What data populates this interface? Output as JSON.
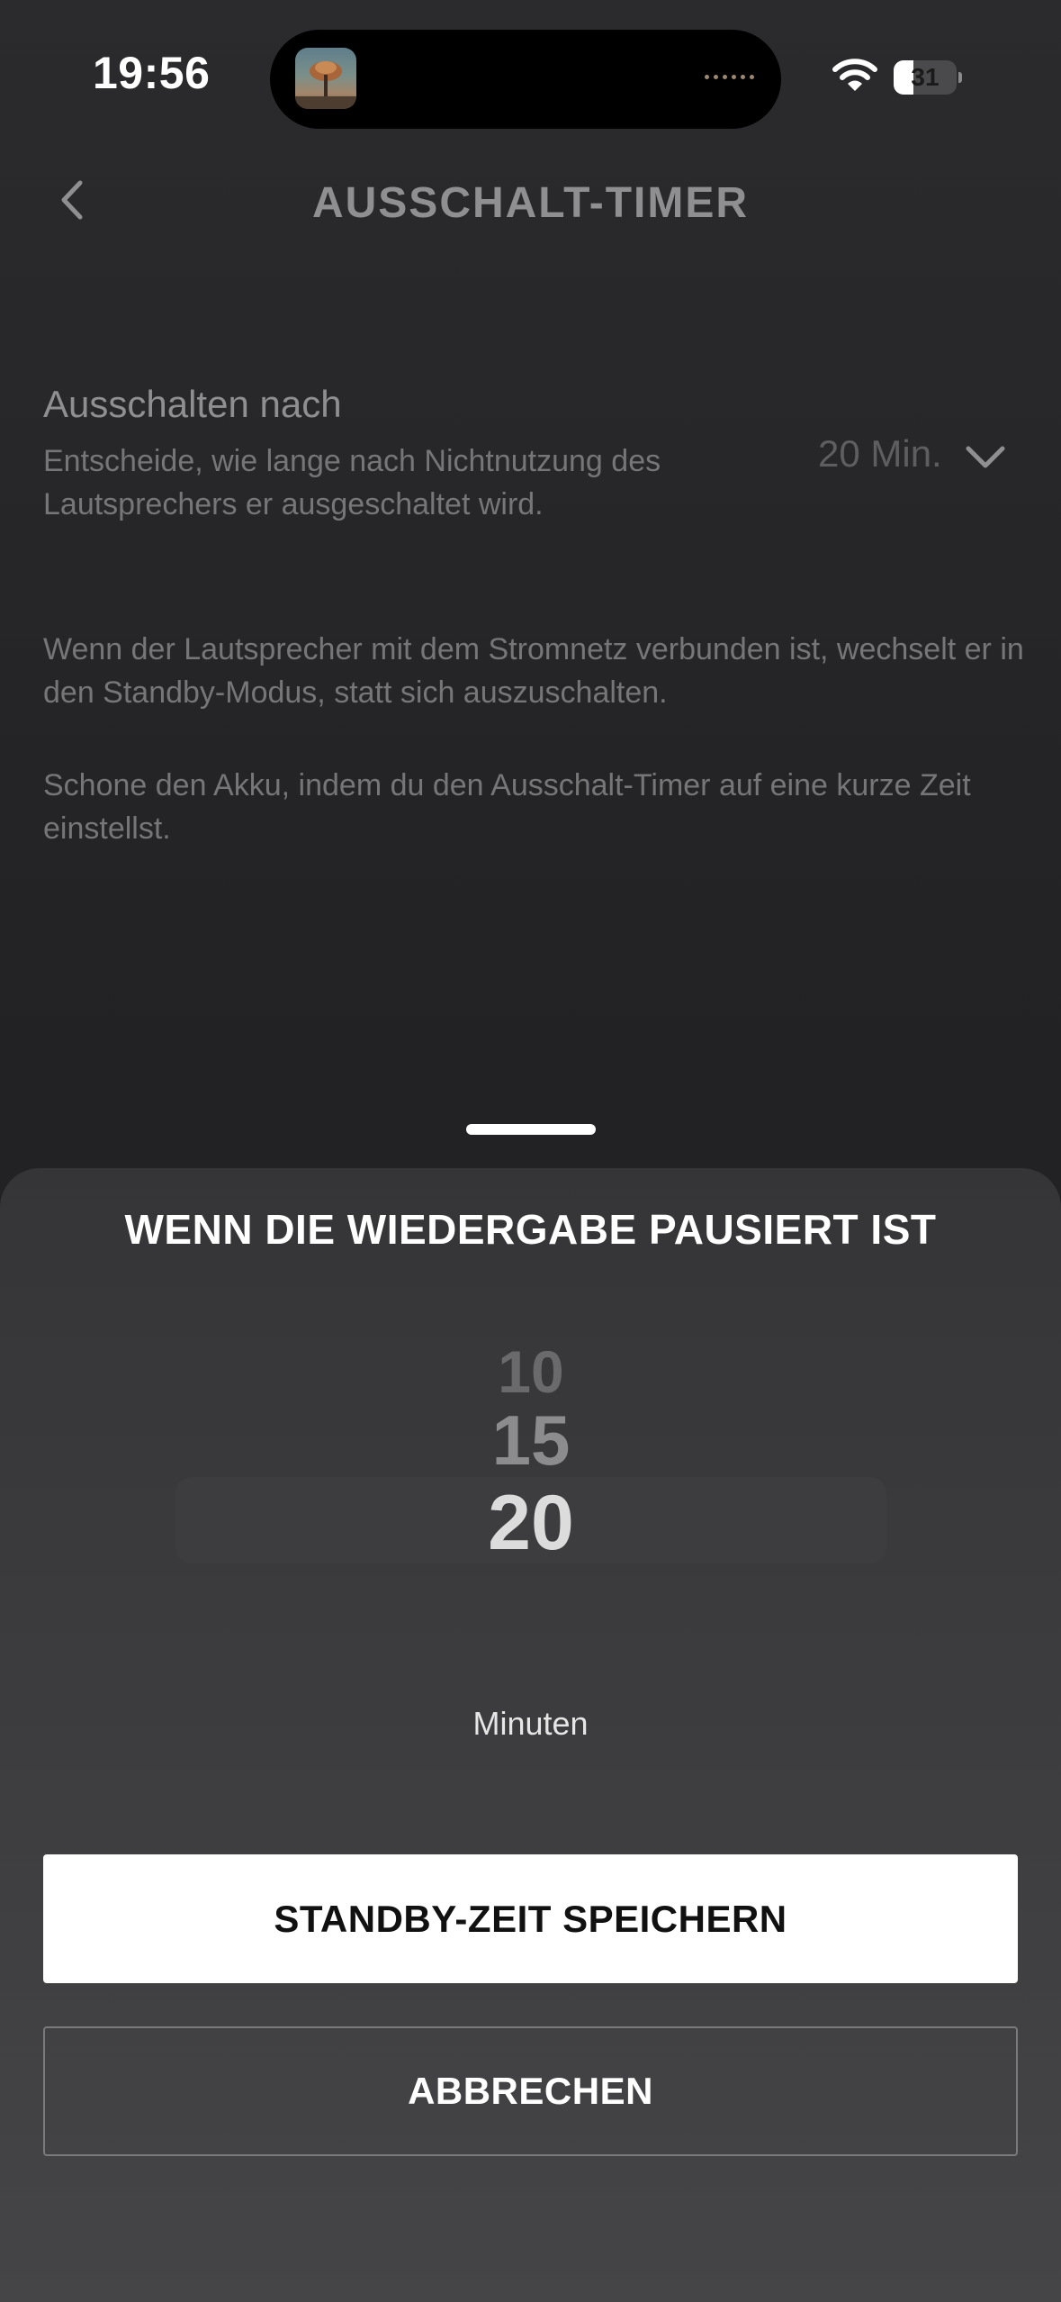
{
  "status_bar": {
    "time": "19:56",
    "battery_level": "31",
    "battery_fraction": 0.31,
    "wifi_icon": "wifi-icon",
    "island_artwork": "now-playing-artwork"
  },
  "header": {
    "title": "AUSSCHALT-TIMER",
    "back_icon": "chevron-left-icon"
  },
  "setting": {
    "title": "Ausschalten nach",
    "description": "Entscheide, wie lange nach Nichtnutzung des Lautsprechers er ausgeschaltet wird.",
    "value": "20 Min.",
    "dropdown_icon": "chevron-down-icon"
  },
  "info": {
    "standby_text": "Wenn der Lautsprecher mit dem Stromnetz verbunden ist, wechselt er in den Standby-Modus, statt sich auszuschalten.",
    "battery_tip": "Schone den Akku, indem du den Ausschalt-Timer auf eine kurze Zeit einstellst."
  },
  "sheet": {
    "title": "WENN DIE WIEDERGABE PAUSIERT IST",
    "picker": {
      "items": [
        "10",
        "15",
        "20"
      ],
      "selected": "20",
      "unit": "Minuten"
    },
    "save_label": "STANDBY-ZEIT SPEICHERN",
    "cancel_label": "ABBRECHEN"
  },
  "colors": {
    "background": "#232325",
    "sheet_background": "#3c3c3e",
    "primary_button": "#ffffff",
    "accent_text": "#ffffff"
  }
}
